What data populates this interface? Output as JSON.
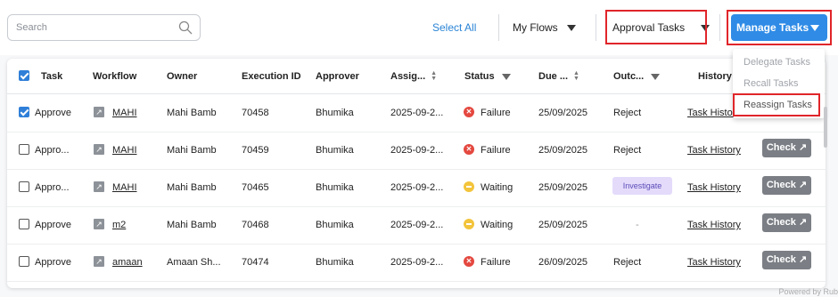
{
  "toolbar": {
    "search_placeholder": "Search",
    "select_all": "Select All",
    "my_flows": "My Flows",
    "approval_tasks": "Approval Tasks",
    "manage_tasks": "Manage Tasks"
  },
  "menu": {
    "delegate": "Delegate Tasks",
    "recall": "Recall Tasks",
    "reassign": "Reassign Tasks"
  },
  "table": {
    "headers": {
      "task": "Task",
      "workflow": "Workflow",
      "owner": "Owner",
      "execution_id": "Execution ID",
      "approver": "Approver",
      "assigned": "Assig...",
      "status": "Status",
      "due": "Due ...",
      "outcome": "Outc...",
      "history": "History"
    },
    "rows": [
      {
        "checked": true,
        "task": "Approve",
        "workflow": "MAHI",
        "owner": "Mahi Bamb",
        "execution_id": "70458",
        "approver": "Bhumika",
        "assigned": "2025-09-2...",
        "status": "Failure",
        "due": "25/09/2025",
        "outcome": "Reject",
        "history": "Task History",
        "check": "Check"
      },
      {
        "checked": false,
        "task": "Appro...",
        "workflow": "MAHI",
        "owner": "Mahi Bamb",
        "execution_id": "70459",
        "approver": "Bhumika",
        "assigned": "2025-09-2...",
        "status": "Failure",
        "due": "25/09/2025",
        "outcome": "Reject",
        "history": "Task History",
        "check": "Check"
      },
      {
        "checked": false,
        "task": "Appro...",
        "workflow": "MAHI",
        "owner": "Mahi Bamb",
        "execution_id": "70465",
        "approver": "Bhumika",
        "assigned": "2025-09-2...",
        "status": "Waiting",
        "due": "25/09/2025",
        "outcome": "Investigate",
        "history": "Task History",
        "check": "Check"
      },
      {
        "checked": false,
        "task": "Approve",
        "workflow": "m2",
        "owner": "Mahi Bamb",
        "execution_id": "70468",
        "approver": "Bhumika",
        "assigned": "2025-09-2...",
        "status": "Waiting",
        "due": "25/09/2025",
        "outcome": "-",
        "history": "Task History",
        "check": "Check"
      },
      {
        "checked": false,
        "task": "Approve",
        "workflow": "amaan",
        "owner": "Amaan Sh...",
        "execution_id": "70474",
        "approver": "Bhumika",
        "assigned": "2025-09-2...",
        "status": "Failure",
        "due": "26/09/2025",
        "outcome": "Reject",
        "history": "Task History",
        "check": "Check"
      }
    ]
  },
  "footer": "Powered by Rub",
  "colors": {
    "accent": "#2f8be6",
    "highlight": "#e0252a",
    "failure": "#e4483f",
    "waiting": "#f3c43b"
  }
}
